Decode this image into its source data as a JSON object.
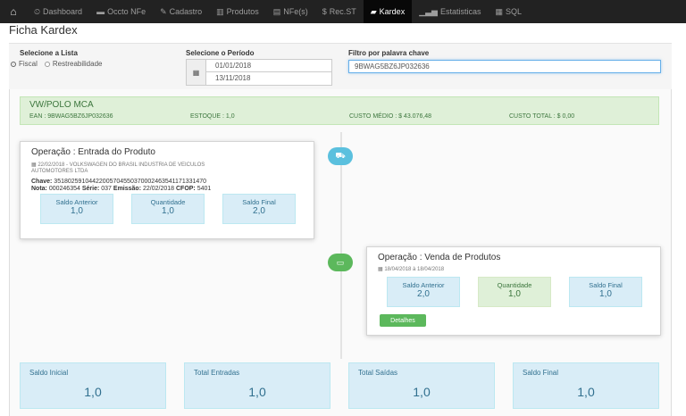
{
  "nav": {
    "home_icon": "home-icon",
    "items": [
      {
        "icon": "dashboard-icon",
        "glyph": "⏲",
        "label": "Dashboard"
      },
      {
        "icon": "car-icon",
        "glyph": "▬",
        "label": "Occto NFe"
      },
      {
        "icon": "edit-icon",
        "glyph": "✎",
        "label": "Cadastro"
      },
      {
        "icon": "barcode-icon",
        "glyph": "▥",
        "label": "Produtos"
      },
      {
        "icon": "file-icon",
        "glyph": "▤",
        "label": "NFe(s)"
      },
      {
        "icon": "dollar-icon",
        "glyph": "$",
        "label": "Rec.ST"
      },
      {
        "icon": "folder-open-icon",
        "glyph": "▰",
        "label": "Kardex"
      },
      {
        "icon": "stats-icon",
        "glyph": "▁▃▅",
        "label": "Estatisticas"
      },
      {
        "icon": "database-icon",
        "glyph": "▦",
        "label": "SQL"
      }
    ],
    "active": "Kardex"
  },
  "page": {
    "title": "Ficha Kardex"
  },
  "filters": {
    "list_label": "Selecione a Lista",
    "list_options": [
      "Fiscal",
      "Restreabilidade"
    ],
    "list_selected": "Fiscal",
    "period_label": "Selecione o Período",
    "date_start": "01/01/2018",
    "date_end": "13/11/2018",
    "search_label": "Filtro por palavra chave",
    "search_value": "9BWAG5BZ6JP032636"
  },
  "product": {
    "name": "VW/POLO MCA",
    "ean": "EAN : 9BWAG5BZ6JP032636",
    "estoque": "ESTOQUE : 1,0",
    "custo_medio": "CUSTO MÉDIO : $ 43.076,48",
    "custo_total": "CUSTO TOTAL : $ 0,00"
  },
  "timeline": [
    {
      "title": "Operação : Entrada do Produto",
      "sub": "22/02/2018 - VOLKSWAGEN DO BRASIL INDUSTRIA DE VEICULOS",
      "sub2": "AUTOMOTORES LTDA",
      "chave_label": "Chave:",
      "chave": "35180259104422005704550370002463541171331470",
      "nota_label": "Nota:",
      "nota": "000246354",
      "serie_label": "Série:",
      "serie": "037",
      "emissao_label": "Emissão:",
      "emissao": "22/02/2018",
      "cfop_label": "CFOP:",
      "cfop": "5401",
      "saldo_anterior_label": "Saldo Anterior",
      "saldo_anterior": "1,0",
      "quantidade_label": "Quantidade",
      "quantidade": "1,0",
      "saldo_final_label": "Saldo Final",
      "saldo_final": "2,0"
    },
    {
      "title": "Operação : Venda de Produtos",
      "sub": "18/04/2018 à 18/04/2018",
      "saldo_anterior_label": "Saldo Anterior",
      "saldo_anterior": "2,0",
      "quantidade_label": "Quantidade",
      "quantidade": "1,0",
      "saldo_final_label": "Saldo Final",
      "saldo_final": "1,0",
      "button": "Detalhes"
    }
  ],
  "totals": [
    {
      "label": "Saldo Inicial",
      "value": "1,0"
    },
    {
      "label": "Total Entradas",
      "value": "1,0"
    },
    {
      "label": "Total Saídas",
      "value": "1,0"
    },
    {
      "label": "Saldo Final",
      "value": "1,0"
    }
  ]
}
